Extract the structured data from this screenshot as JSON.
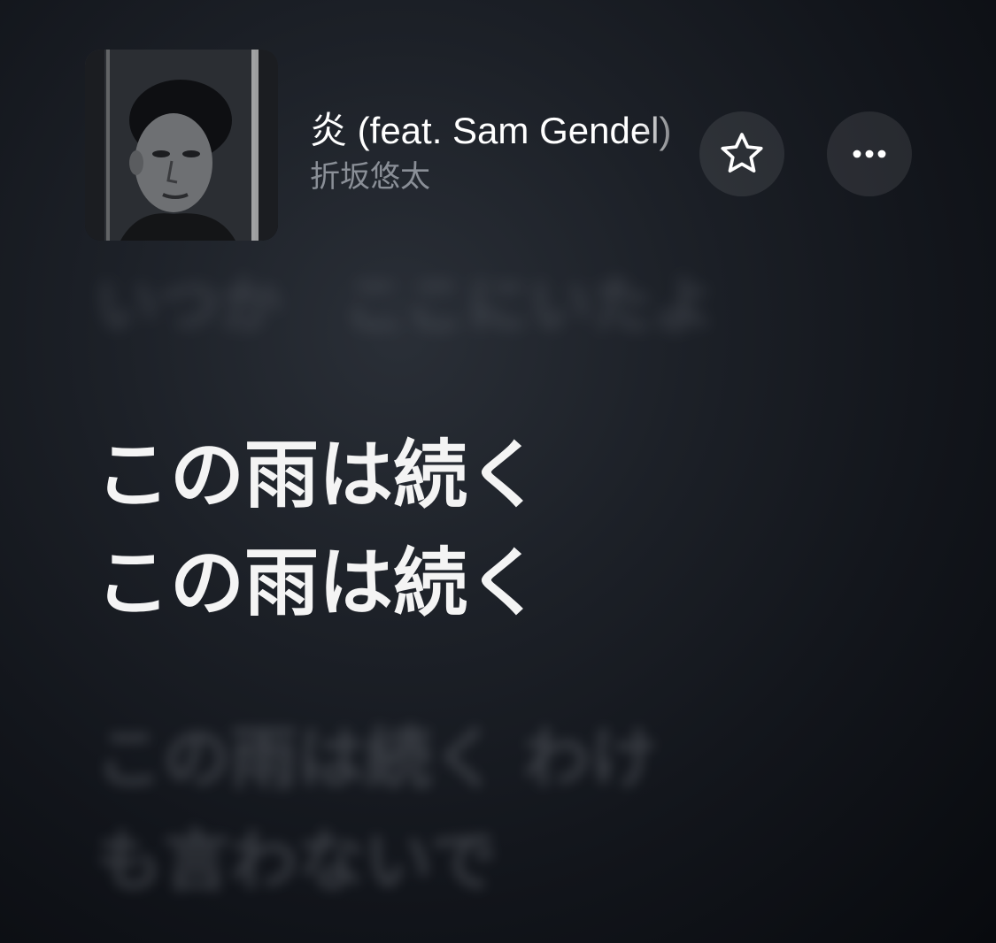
{
  "now_playing": {
    "title": "炎 (feat. Sam Gendel)",
    "artist": "折坂悠太"
  },
  "controls": {
    "favorite_icon": "star-outline-icon",
    "more_icon": "ellipsis-icon"
  },
  "lyrics": {
    "previous": "いつか　ここにいたよ",
    "current": [
      "この雨は続く",
      "この雨は続く"
    ],
    "next": [
      "この雨は続く わけ",
      "も言わないで"
    ]
  },
  "colors": {
    "current_lyric": "#f4f4f4",
    "artist_text": "#8a8f97",
    "button_bg": "#2a2e35"
  }
}
